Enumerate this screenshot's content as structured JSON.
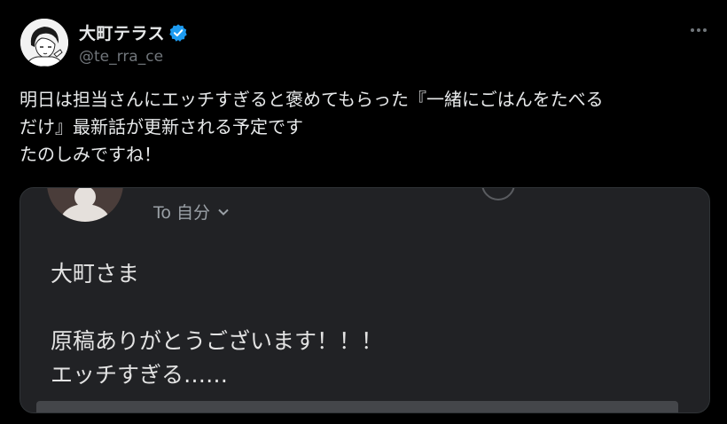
{
  "author": {
    "display_name": "大町テラス",
    "handle": "@te_rra_ce",
    "verified_icon": "verified-badge-icon",
    "avatar_icon": "manga-character-avatar"
  },
  "actions": {
    "more_icon": "more-horizontal-icon"
  },
  "tweet": {
    "lines": [
      "明日は担当さんにエッチすぎると褒めてもらった『一緒にごはんをたべる",
      "だけ』最新話が更新される予定です",
      "たのしみですね！"
    ]
  },
  "email": {
    "recipient": "To 自分",
    "greeting": "大町さま",
    "line1": "原稿ありがとうございます！！！",
    "line2": "エッチすぎる……"
  },
  "colors": {
    "background": "#000000",
    "text": "#e7e9ea",
    "secondary_text": "#71767b",
    "verified": "#1d9bf0",
    "card_background": "#212225"
  }
}
